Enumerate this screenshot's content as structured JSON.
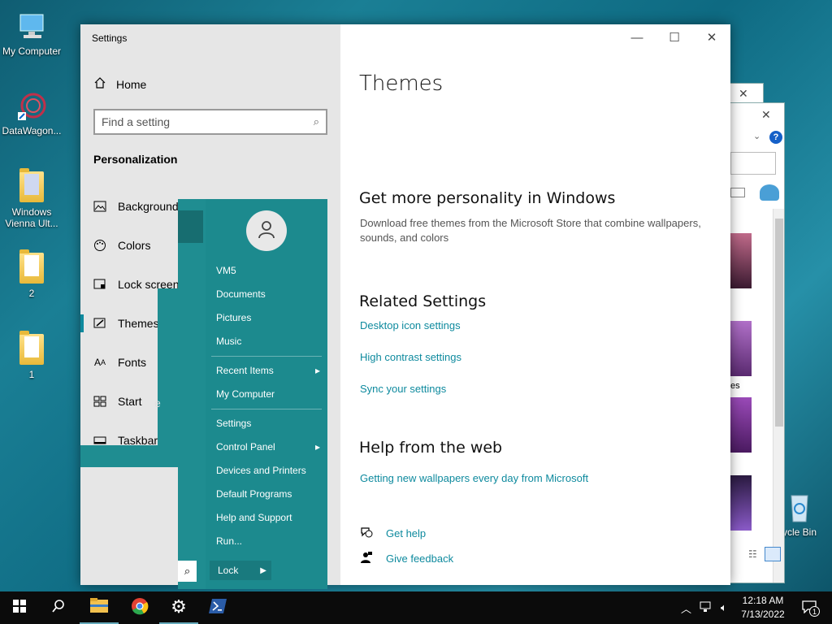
{
  "desktop": {
    "icons": [
      {
        "label": "My Computer"
      },
      {
        "label": "DataWagon..."
      },
      {
        "label": "Windows Vienna Ult..."
      },
      {
        "label": "2"
      },
      {
        "label": "1"
      }
    ],
    "recycle_label": "ycle Bin"
  },
  "background_window": {
    "truncated_label": "es"
  },
  "settings": {
    "window_title": "Settings",
    "home_label": "Home",
    "search_placeholder": "Find a setting",
    "section_title": "Personalization",
    "nav_items": [
      {
        "label": "Background"
      },
      {
        "label": "Colors"
      },
      {
        "label": "Lock screen"
      },
      {
        "label": "Themes"
      },
      {
        "label": "Fonts"
      },
      {
        "label": "Start"
      },
      {
        "label": "Taskbar"
      }
    ],
    "start_nav_suffix": "e",
    "page_title": "Themes",
    "personality": {
      "heading": "Get more personality in Windows",
      "text": "Download free themes from the Microsoft Store that combine wallpapers, sounds, and colors"
    },
    "related": {
      "heading": "Related Settings",
      "links": [
        "Desktop icon settings",
        "High contrast settings",
        "Sync your settings"
      ]
    },
    "help_web": {
      "heading": "Help from the web",
      "link": "Getting new wallpapers every day from Microsoft"
    },
    "get_help": "Get help",
    "give_feedback": "Give feedback"
  },
  "start_menu": {
    "user_name": "VM5",
    "items_top": [
      "Documents",
      "Pictures",
      "Music"
    ],
    "items_mid": [
      {
        "label": "Recent Items",
        "arrow": "▸"
      },
      {
        "label": "My Computer",
        "arrow": ""
      }
    ],
    "items_bottom": [
      {
        "label": "Settings",
        "arrow": ""
      },
      {
        "label": "Control Panel",
        "arrow": "▸"
      },
      {
        "label": "Devices and Printers",
        "arrow": ""
      },
      {
        "label": "Default Programs",
        "arrow": ""
      },
      {
        "label": "Help and Support",
        "arrow": ""
      },
      {
        "label": "Run...",
        "arrow": ""
      }
    ],
    "lock_label": "Lock"
  },
  "taskbar": {
    "time": "12:18 AM",
    "date": "7/13/2022",
    "notification_count": "1"
  },
  "colors": {
    "accent": "#0e8a9e",
    "start_menu": "#1f8d91",
    "taskbar": "#0b0b0b"
  }
}
